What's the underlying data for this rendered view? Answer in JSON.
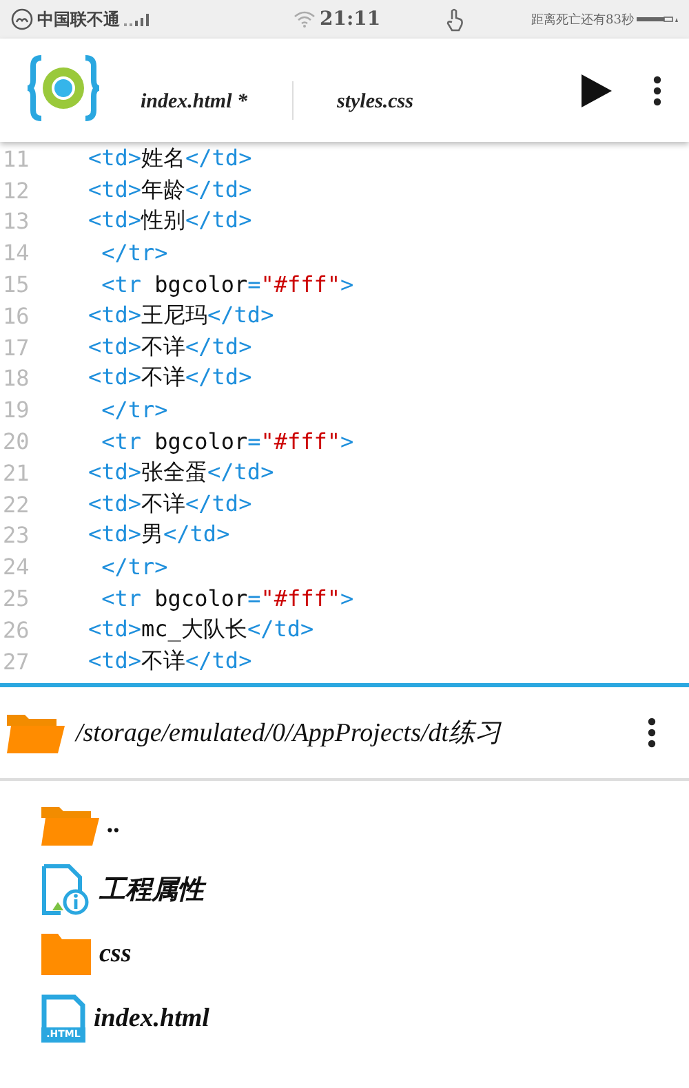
{
  "status_bar": {
    "carrier": "中国联不通",
    "time": "21:11",
    "notice": "距离死亡还有83秒"
  },
  "toolbar": {
    "tabs": [
      {
        "label": "index.html *"
      },
      {
        "label": "styles.css"
      }
    ]
  },
  "editor": {
    "lines": [
      {
        "number": "11",
        "tokens": [
          {
            "kind": "tag",
            "text": "<td>"
          },
          {
            "kind": "text",
            "text": "姓名"
          },
          {
            "kind": "tag",
            "text": "</td>"
          }
        ]
      },
      {
        "number": "12",
        "tokens": [
          {
            "kind": "tag",
            "text": "<td>"
          },
          {
            "kind": "text",
            "text": "年龄"
          },
          {
            "kind": "tag",
            "text": "</td>"
          }
        ]
      },
      {
        "number": "13",
        "tokens": [
          {
            "kind": "tag",
            "text": "<td>"
          },
          {
            "kind": "text",
            "text": "性别"
          },
          {
            "kind": "tag",
            "text": "</td>"
          }
        ]
      },
      {
        "number": "14",
        "tokens": [
          {
            "kind": "tag",
            "text": " </tr>"
          }
        ]
      },
      {
        "number": "15",
        "tokens": [
          {
            "kind": "tag",
            "text": " <tr"
          },
          {
            "kind": "text",
            "text": " bgcolor"
          },
          {
            "kind": "tag",
            "text": "="
          },
          {
            "kind": "string",
            "text": "\"#fff\""
          },
          {
            "kind": "tag",
            "text": ">"
          }
        ]
      },
      {
        "number": "16",
        "tokens": [
          {
            "kind": "tag",
            "text": "<td>"
          },
          {
            "kind": "text",
            "text": "王尼玛"
          },
          {
            "kind": "tag",
            "text": "</td>"
          }
        ]
      },
      {
        "number": "17",
        "tokens": [
          {
            "kind": "tag",
            "text": "<td>"
          },
          {
            "kind": "text",
            "text": "不详"
          },
          {
            "kind": "tag",
            "text": "</td>"
          }
        ]
      },
      {
        "number": "18",
        "tokens": [
          {
            "kind": "tag",
            "text": "<td>"
          },
          {
            "kind": "text",
            "text": "不详"
          },
          {
            "kind": "tag",
            "text": "</td>"
          }
        ]
      },
      {
        "number": "19",
        "tokens": [
          {
            "kind": "tag",
            "text": " </tr>"
          }
        ]
      },
      {
        "number": "20",
        "tokens": [
          {
            "kind": "tag",
            "text": " <tr"
          },
          {
            "kind": "text",
            "text": " bgcolor"
          },
          {
            "kind": "tag",
            "text": "="
          },
          {
            "kind": "string",
            "text": "\"#fff\""
          },
          {
            "kind": "tag",
            "text": ">"
          }
        ]
      },
      {
        "number": "21",
        "tokens": [
          {
            "kind": "tag",
            "text": "<td>"
          },
          {
            "kind": "text",
            "text": "张全蛋"
          },
          {
            "kind": "tag",
            "text": "</td>"
          }
        ]
      },
      {
        "number": "22",
        "tokens": [
          {
            "kind": "tag",
            "text": "<td>"
          },
          {
            "kind": "text",
            "text": "不详"
          },
          {
            "kind": "tag",
            "text": "</td>"
          }
        ]
      },
      {
        "number": "23",
        "tokens": [
          {
            "kind": "tag",
            "text": "<td>"
          },
          {
            "kind": "text",
            "text": "男"
          },
          {
            "kind": "tag",
            "text": "</td>"
          }
        ]
      },
      {
        "number": "24",
        "tokens": [
          {
            "kind": "tag",
            "text": " </tr>"
          }
        ]
      },
      {
        "number": "25",
        "tokens": [
          {
            "kind": "tag",
            "text": " <tr"
          },
          {
            "kind": "text",
            "text": " bgcolor"
          },
          {
            "kind": "tag",
            "text": "="
          },
          {
            "kind": "string",
            "text": "\"#fff\""
          },
          {
            "kind": "tag",
            "text": ">"
          }
        ]
      },
      {
        "number": "26",
        "tokens": [
          {
            "kind": "tag",
            "text": "<td>"
          },
          {
            "kind": "text",
            "text": "mc_大队长"
          },
          {
            "kind": "tag",
            "text": "</td>"
          }
        ]
      },
      {
        "number": "27",
        "tokens": [
          {
            "kind": "tag",
            "text": "<td>"
          },
          {
            "kind": "text",
            "text": "不详"
          },
          {
            "kind": "tag",
            "text": "</td>"
          }
        ]
      }
    ]
  },
  "file_browser": {
    "path": "/storage/emulated/0/AppProjects/dt练习",
    "items": [
      {
        "kind": "parent",
        "name": ".."
      },
      {
        "kind": "project",
        "name": "工程属性"
      },
      {
        "kind": "folder",
        "name": "css"
      },
      {
        "kind": "html",
        "name": "index.html",
        "badge": ".HTML"
      }
    ]
  }
}
